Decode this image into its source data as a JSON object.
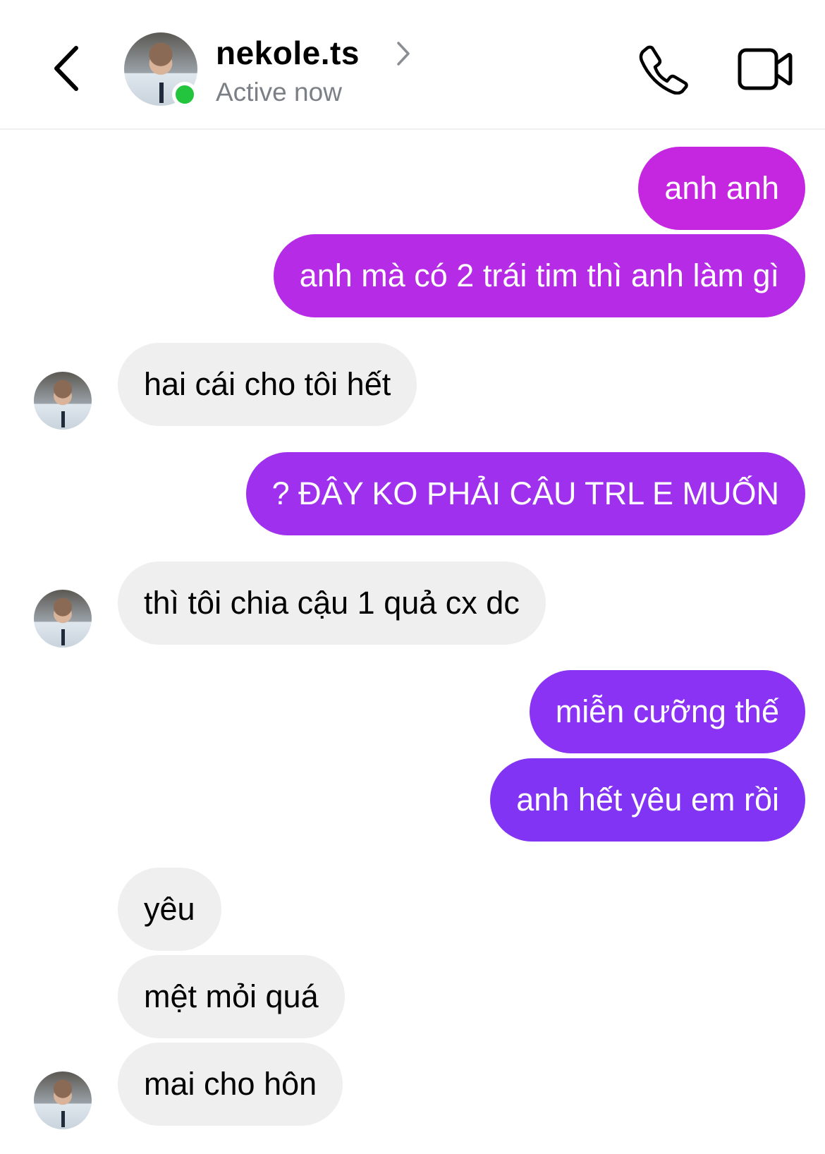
{
  "header": {
    "username": "nekole.ts",
    "status": "Active now"
  },
  "messages": [
    {
      "side": "out",
      "text": "anh anh",
      "color": "#c527e0"
    },
    {
      "side": "out",
      "text": "anh mà có 2 trái tim thì anh làm gì",
      "color": "#b62be6"
    },
    {
      "side": "in",
      "text": "hai cái cho tôi hết"
    },
    {
      "side": "out",
      "text": "? ĐÂY KO PHẢI CÂU TRL E MUỐN",
      "color": "#9e30ee"
    },
    {
      "side": "in",
      "text": "thì tôi chia cậu 1 quả cx dc"
    },
    {
      "side": "out",
      "text": "miễn cưỡng thế",
      "color": "#8a33f4"
    },
    {
      "side": "out",
      "text": "anh hết yêu em rồi",
      "color": "#8234f5"
    },
    {
      "side": "in",
      "text": "yêu"
    },
    {
      "side": "in",
      "text": "mệt mỏi quá"
    },
    {
      "side": "in",
      "text": "mai cho hôn"
    }
  ],
  "colors": {
    "online": "#22c53d",
    "incoming_bubble": "#efeff0"
  },
  "icons": [
    "back-chevron-icon",
    "chevron-right-icon",
    "phone-icon",
    "video-camera-icon"
  ]
}
